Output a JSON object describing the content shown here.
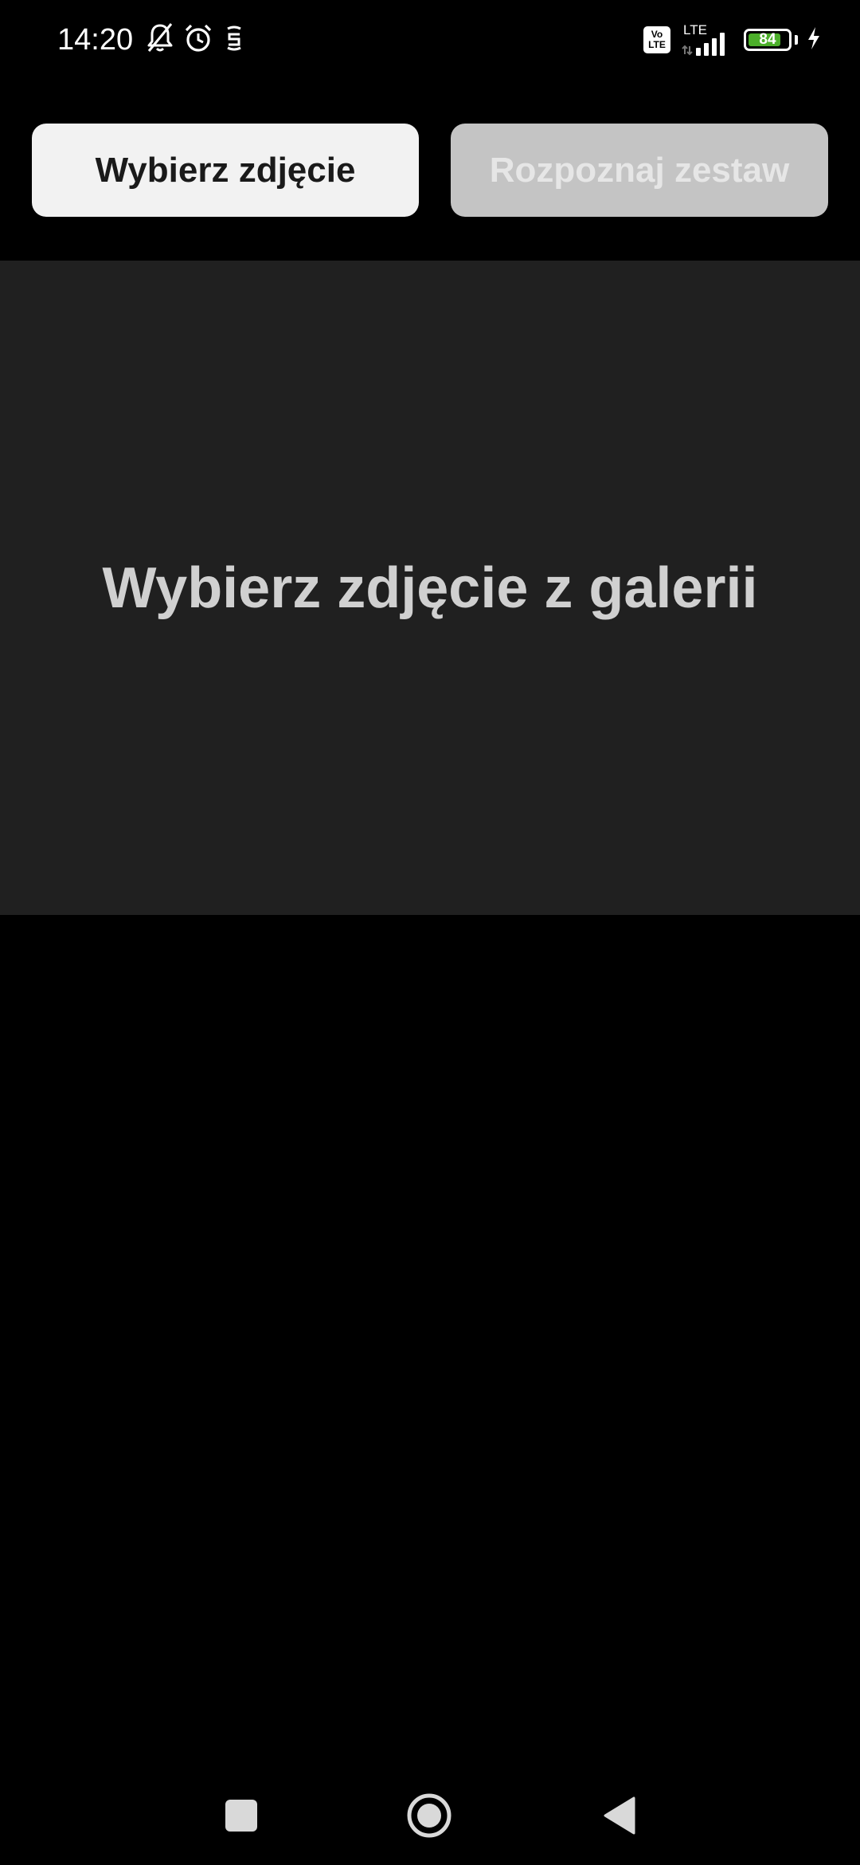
{
  "status_bar": {
    "time": "14:20",
    "icons_left": [
      "bell-off-icon",
      "alarm-icon",
      "sim-icon"
    ],
    "volte_label_top": "Vo",
    "volte_label_bottom": "LTE",
    "network_label": "LTE",
    "battery_level": "84",
    "battery_fraction": 0.84,
    "battery_color": "#4caf2a",
    "charging": true
  },
  "toolbar": {
    "pick_photo_label": "Wybierz zdjęcie",
    "recognize_set_label": "Rozpoznaj zestaw",
    "recognize_enabled": false
  },
  "preview": {
    "placeholder": "Wybierz zdjęcie z galerii"
  },
  "nav_bar": {
    "buttons": [
      "recents-icon",
      "home-icon",
      "back-icon"
    ]
  },
  "colors": {
    "background": "#000000",
    "preview_background": "#202020",
    "button_enabled": "#f2f2f2",
    "button_disabled": "#c4c4c4"
  }
}
